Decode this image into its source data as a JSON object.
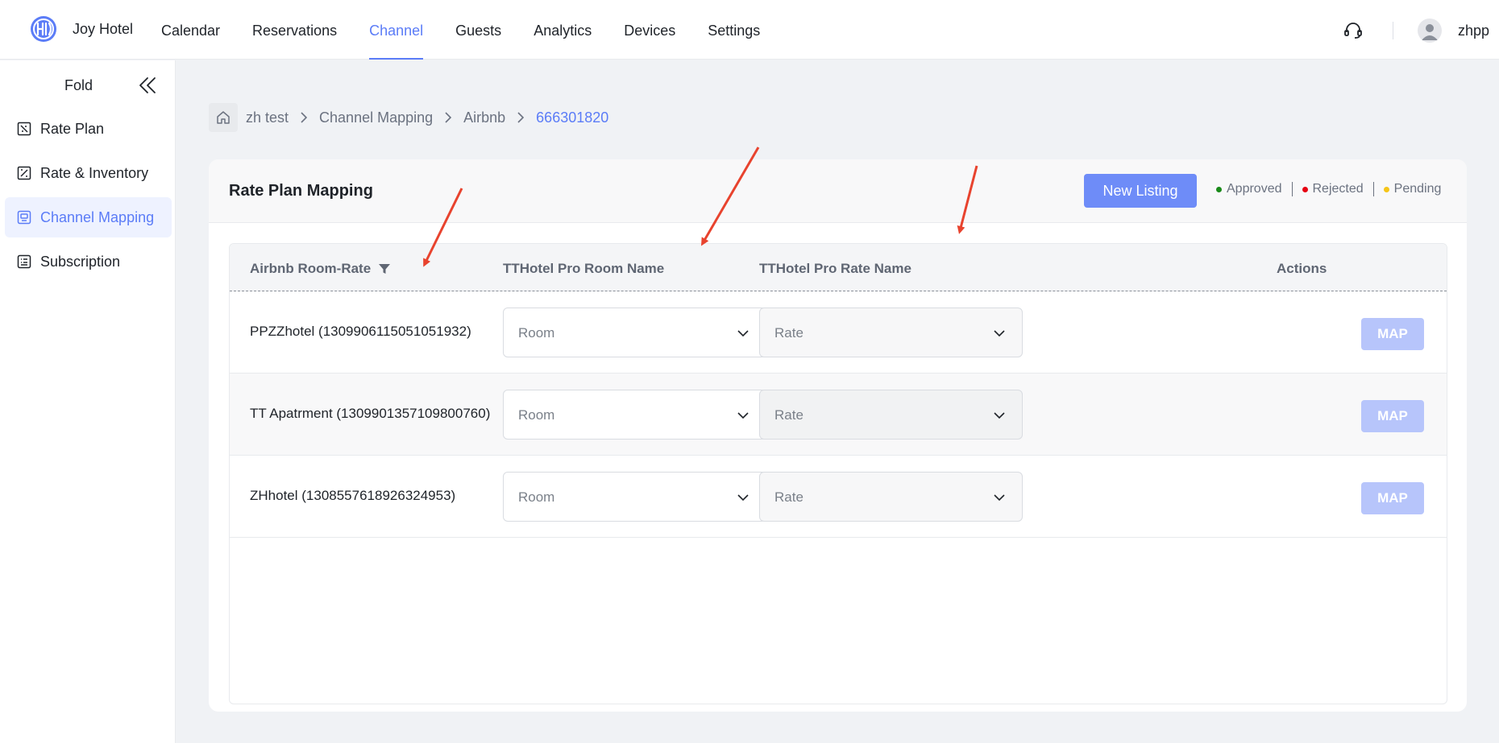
{
  "header": {
    "brand_name": "Joy Hotel",
    "nav": [
      {
        "label": "Calendar"
      },
      {
        "label": "Reservations"
      },
      {
        "label": "Channel",
        "active": true
      },
      {
        "label": "Guests"
      },
      {
        "label": "Analytics"
      },
      {
        "label": "Devices"
      },
      {
        "label": "Settings"
      }
    ],
    "support_icon": "headset-icon",
    "user_name": "zhpp",
    "accent_color": "#5b7cf7"
  },
  "sidebar": {
    "fold_label": "Fold",
    "items": [
      {
        "label": "Rate Plan",
        "icon": "rate-plan-icon"
      },
      {
        "label": "Rate & Inventory",
        "icon": "inventory-icon"
      },
      {
        "label": "Channel Mapping",
        "icon": "channel-mapping-icon",
        "active": true
      },
      {
        "label": "Subscription",
        "icon": "subscription-icon"
      }
    ]
  },
  "breadcrumb": {
    "items": [
      "zh test",
      "Channel Mapping",
      "Airbnb"
    ],
    "current": "666301820"
  },
  "card": {
    "title": "Rate Plan Mapping",
    "new_listing_label": "New Listing",
    "legend": [
      {
        "label": "Approved",
        "color": "#1a8a1a"
      },
      {
        "label": "Rejected",
        "color": "#e60012"
      },
      {
        "label": "Pending",
        "color": "#f5c518"
      }
    ]
  },
  "table": {
    "columns": [
      "Airbnb Room-Rate",
      "TTHotel Pro Room Name",
      "TTHotel Pro Rate Name",
      "Actions"
    ],
    "rows": [
      {
        "name": "PPZZhotel (1309906115051051932)",
        "room_placeholder": "Room",
        "rate_placeholder": "Rate",
        "action": "MAP"
      },
      {
        "name": "TT Apatrment (1309901357109800760)",
        "room_placeholder": "Room",
        "rate_placeholder": "Rate",
        "action": "MAP"
      },
      {
        "name": "ZHhotel (1308557618926324953)",
        "room_placeholder": "Room",
        "rate_placeholder": "Rate",
        "action": "MAP"
      }
    ]
  },
  "annotations": {
    "arrow_color": "#e8432e"
  }
}
